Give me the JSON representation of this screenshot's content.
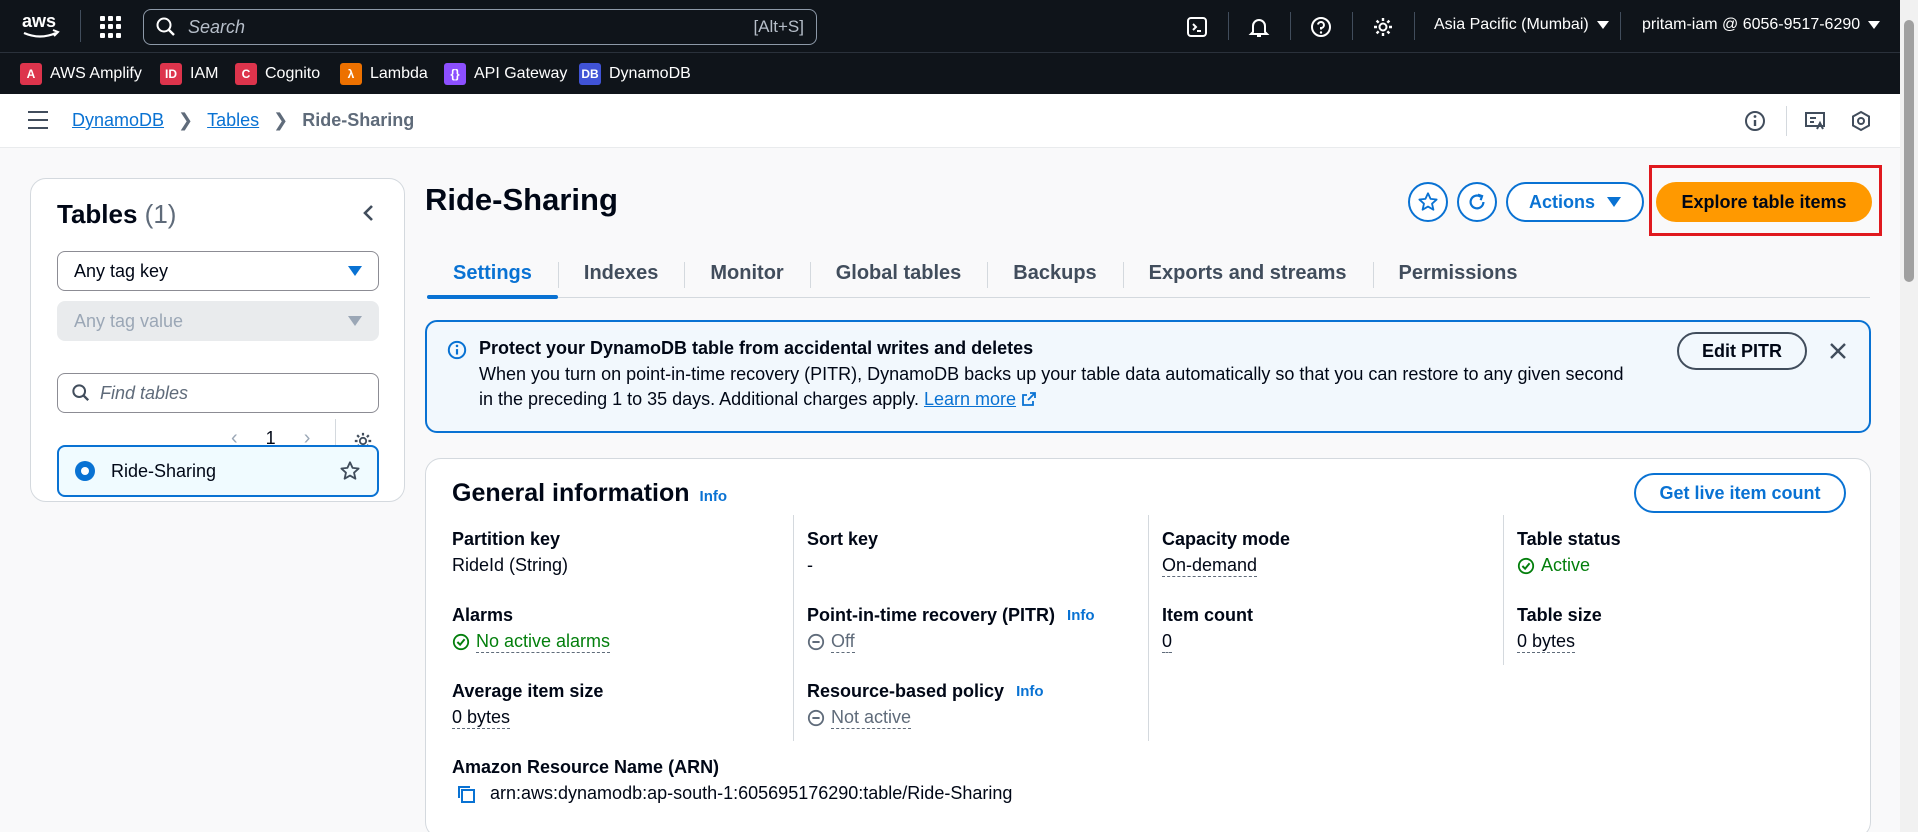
{
  "topnav": {
    "search_placeholder": "Search",
    "search_shortcut": "[Alt+S]",
    "region": "Asia Pacific (Mumbai)",
    "account": "pritam-iam @ 6056-9517-6290",
    "icons": [
      "cloudshell-icon",
      "bell-icon",
      "help-icon",
      "settings-icon"
    ]
  },
  "favorites": [
    {
      "label": "AWS Amplify",
      "color": "#dd344c"
    },
    {
      "label": "IAM",
      "color": "#dd344c"
    },
    {
      "label": "Cognito",
      "color": "#dd344c"
    },
    {
      "label": "Lambda",
      "color": "#ed7100"
    },
    {
      "label": "API Gateway",
      "color": "#8c4fff"
    },
    {
      "label": "DynamoDB",
      "color": "#4053d6"
    }
  ],
  "breadcrumb": {
    "items": [
      "DynamoDB",
      "Tables"
    ],
    "current": "Ride-Sharing"
  },
  "sidebar": {
    "title": "Tables",
    "count": "(1)",
    "tag_key": "Any tag key",
    "tag_value": "Any tag value",
    "find_placeholder": "Find tables",
    "page": "1",
    "tables": [
      {
        "name": "Ride-Sharing",
        "selected": true
      }
    ]
  },
  "page": {
    "title": "Ride-Sharing",
    "actions_label": "Actions",
    "explore_label": "Explore table items",
    "tabs": [
      "Settings",
      "Indexes",
      "Monitor",
      "Global tables",
      "Backups",
      "Exports and streams",
      "Permissions"
    ],
    "active_tab": "Settings"
  },
  "banner": {
    "title": "Protect your DynamoDB table from accidental writes and deletes",
    "text": "When you turn on point-in-time recovery (PITR), DynamoDB backs up your table data automatically so that you can restore to any given second in the preceding 1 to 35 days. Additional charges apply.",
    "link": "Learn more",
    "button": "Edit PITR"
  },
  "general": {
    "title": "General information",
    "info": "Info",
    "live_count_button": "Get live item count",
    "partition_key_label": "Partition key",
    "partition_key_value": "RideId (String)",
    "sort_key_label": "Sort key",
    "sort_key_value": "-",
    "capacity_label": "Capacity mode",
    "capacity_value": "On-demand",
    "status_label": "Table status",
    "status_value": "Active",
    "alarms_label": "Alarms",
    "alarms_value": "No active alarms",
    "pitr_label": "Point-in-time recovery (PITR)",
    "pitr_value": "Off",
    "item_count_label": "Item count",
    "item_count_value": "0",
    "table_size_label": "Table size",
    "table_size_value": "0 bytes",
    "avg_size_label": "Average item size",
    "avg_size_value": "0 bytes",
    "policy_label": "Resource-based policy",
    "policy_value": "Not active",
    "arn_label": "Amazon Resource Name (ARN)",
    "arn_value": "arn:aws:dynamodb:ap-south-1:605695176290:table/Ride-Sharing"
  }
}
